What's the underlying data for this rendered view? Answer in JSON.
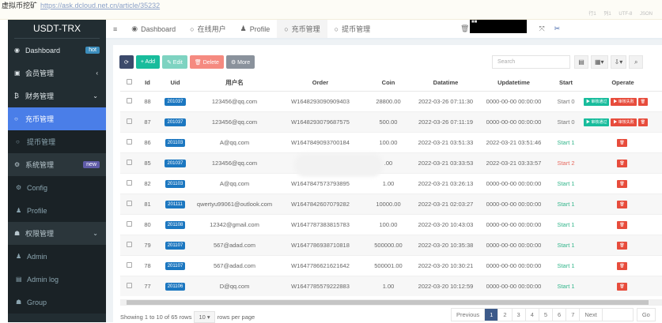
{
  "browser": {
    "title": "虚拟币挖矿",
    "link": "https://ask.dcloud.net.cn/article/35232",
    "status": "行1 列1 UTF-8 JSON"
  },
  "sidebar": {
    "logo": "USDT-TRX",
    "items": [
      {
        "label": "Dashboard",
        "icon": "dashboard-icon",
        "badge": "hot",
        "badge_color": "#3c8dbc",
        "type": "head"
      },
      {
        "label": "会员管理",
        "icon": "user-card-icon",
        "arrow": "‹",
        "type": "head"
      },
      {
        "label": "财务管理",
        "icon": "bitcoin-icon",
        "arrow": "⌄",
        "type": "head"
      },
      {
        "label": "充币管理",
        "icon": "circle-icon",
        "type": "active"
      },
      {
        "label": "提币管理",
        "icon": "circle-icon",
        "type": "sub"
      },
      {
        "label": "系统管理",
        "icon": "cogs-icon",
        "badge": "new",
        "badge_color": "#605ca8",
        "type": "grp"
      },
      {
        "label": "Config",
        "icon": "gear-icon",
        "type": "sub"
      },
      {
        "label": "Profile",
        "icon": "user-icon",
        "type": "sub"
      },
      {
        "label": "权限管理",
        "icon": "group-icon",
        "arrow": "⌄",
        "type": "grp"
      },
      {
        "label": "Admin",
        "icon": "user-icon",
        "type": "sub"
      },
      {
        "label": "Admin log",
        "icon": "list-icon",
        "type": "sub"
      },
      {
        "label": "Group",
        "icon": "group-icon",
        "type": "sub"
      }
    ]
  },
  "header": {
    "tabs": [
      {
        "label": "Dashboard",
        "icon": "dashboard-icon"
      },
      {
        "label": "在线用户",
        "icon": "circle-icon"
      },
      {
        "label": "Profile",
        "icon": "user-icon"
      },
      {
        "label": "充币管理",
        "icon": "circle-icon",
        "active": true
      },
      {
        "label": "提币管理",
        "icon": "circle-icon"
      }
    ]
  },
  "toolbar": {
    "refresh": "⟳",
    "add": "+ Add",
    "edit": "✎ Edit",
    "delete": "🗑 Delete",
    "more": "⚙ More",
    "search_placeholder": "Search"
  },
  "table": {
    "columns": [
      "Id",
      "Uid",
      "用户名",
      "Order",
      "Coin",
      "Datatime",
      "Updatetime",
      "Start",
      "Operate"
    ],
    "approve_label": "▶ 审核通过",
    "reject_label": "▶ 审核失败",
    "rows": [
      {
        "id": "88",
        "uid": "201037",
        "user": "123456@qq.com",
        "order": "W1648293090909403",
        "coin": "28800.00",
        "dt": "2022-03-26 07:11:30",
        "ut": "0000-00-00 00:00:00",
        "start": "Start 0",
        "s": 0
      },
      {
        "id": "87",
        "uid": "201037",
        "user": "123456@qq.com",
        "order": "W1648293079687575",
        "coin": "500.00",
        "dt": "2022-03-26 07:11:19",
        "ut": "0000-00-00 00:00:00",
        "start": "Start 0",
        "s": 0
      },
      {
        "id": "86",
        "uid": "201103",
        "user": "A@qq.com",
        "order": "W1647849093700184",
        "coin": "100.00",
        "dt": "2022-03-21 03:51:33",
        "ut": "2022-03-21 03:51:46",
        "start": "Start 1",
        "s": 1
      },
      {
        "id": "85",
        "uid": "201037",
        "user": "123456@qq.com",
        "order": "",
        "coin": ".00",
        "dt": "2022-03-21 03:33:53",
        "ut": "2022-03-21 03:33:57",
        "start": "Start 2",
        "s": 2
      },
      {
        "id": "82",
        "uid": "201103",
        "user": "A@qq.com",
        "order": "W1647847573793895",
        "coin": "1.00",
        "dt": "2022-03-21 03:26:13",
        "ut": "0000-00-00 00:00:00",
        "start": "Start 1",
        "s": 1
      },
      {
        "id": "81",
        "uid": "201111",
        "user": "qwertyu99061@outlook.com",
        "order": "W1647842607079282",
        "coin": "10000.00",
        "dt": "2022-03-21 02:03:27",
        "ut": "0000-00-00 00:00:00",
        "start": "Start 1",
        "s": 1
      },
      {
        "id": "80",
        "uid": "201108",
        "user": "12342@gmail.com",
        "order": "W1647787383815783",
        "coin": "100.00",
        "dt": "2022-03-20 10:43:03",
        "ut": "0000-00-00 00:00:00",
        "start": "Start 1",
        "s": 1
      },
      {
        "id": "79",
        "uid": "201107",
        "user": "567@adad.com",
        "order": "W1647786938710818",
        "coin": "500000.00",
        "dt": "2022-03-20 10:35:38",
        "ut": "0000-00-00 00:00:00",
        "start": "Start 1",
        "s": 1
      },
      {
        "id": "78",
        "uid": "201107",
        "user": "567@adad.com",
        "order": "W1647786621621642",
        "coin": "500001.00",
        "dt": "2022-03-20 10:30:21",
        "ut": "0000-00-00 00:00:00",
        "start": "Start 1",
        "s": 1
      },
      {
        "id": "77",
        "uid": "201106",
        "user": "D@qq.com",
        "order": "W1647785579222883",
        "coin": "1.00",
        "dt": "2022-03-20 10:12:59",
        "ut": "0000-00-00 00:00:00",
        "start": "Start 1",
        "s": 1
      }
    ]
  },
  "footer": {
    "showing": "Showing 1 to 10 of 65 rows",
    "page_size": "10 ▾",
    "rows_per_page": "rows per page",
    "pages": [
      "Previous",
      "1",
      "2",
      "3",
      "4",
      "5",
      "6",
      "7",
      "Next"
    ],
    "current_page": "1",
    "go": "Go"
  },
  "colors": {
    "sidebar": "#222d32",
    "active": "#4a7ee8",
    "add": "#18bc9c",
    "edit": "#7ed3c1",
    "delete": "#f58a80",
    "more": "#8a929c",
    "refresh": "#3c4a6b",
    "approve": "#18bc9c",
    "reject": "#e74c3c"
  }
}
